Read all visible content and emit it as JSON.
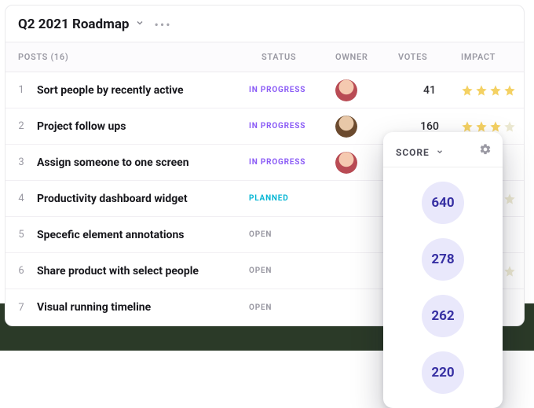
{
  "header": {
    "title": "Q2 2021 Roadmap"
  },
  "columns": {
    "posts_label": "POSTS",
    "posts_count": "(16)",
    "status": "STATUS",
    "owner": "OWNER",
    "votes": "VOTES",
    "impact": "IMPACT"
  },
  "status_labels": {
    "in_progress": "IN PROGRESS",
    "planned": "PLANNED",
    "open": "OPEN"
  },
  "rows": [
    {
      "idx": "1",
      "title": "Sort people by recently active",
      "status": "in_progress",
      "owner": "a",
      "votes": "41",
      "stars": 4
    },
    {
      "idx": "2",
      "title": "Project follow ups",
      "status": "in_progress",
      "owner": "b",
      "votes": "160",
      "stars": 3
    },
    {
      "idx": "3",
      "title": "Assign someone to one screen",
      "status": "in_progress",
      "owner": "a",
      "votes": "",
      "stars": 0
    },
    {
      "idx": "4",
      "title": "Productivity dashboard widget",
      "status": "planned",
      "owner": "",
      "votes": "",
      "stars": 1
    },
    {
      "idx": "5",
      "title": "Specefic element annotations",
      "status": "open",
      "owner": "",
      "votes": "",
      "stars": 0
    },
    {
      "idx": "6",
      "title": "Share product with select people",
      "status": "open",
      "owner": "",
      "votes": "",
      "stars": 1
    },
    {
      "idx": "7",
      "title": "Visual running timeline",
      "status": "open",
      "owner": "",
      "votes": "",
      "stars": 0
    }
  ],
  "popover": {
    "label": "SCORE",
    "scores": [
      "640",
      "278",
      "262",
      "220"
    ]
  }
}
